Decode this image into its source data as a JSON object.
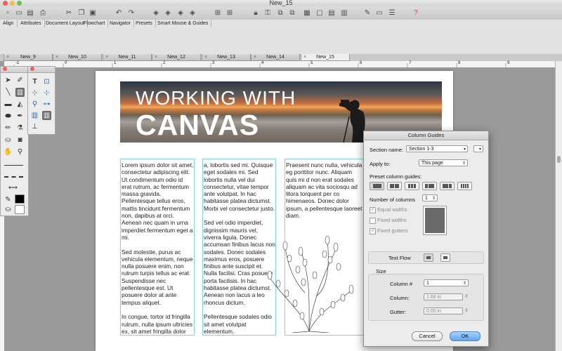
{
  "window": {
    "title": "New_15"
  },
  "colors": {
    "guide": "#7fd6df",
    "selected_tool": "#6b6b6b",
    "ok_button": "#5ea6ee"
  },
  "toolbar": {
    "icons": [
      "new-document-icon",
      "open-icon",
      "save-icon",
      "print-icon",
      "cut-icon",
      "copy-icon",
      "paste-icon",
      "undo-icon",
      "redo-icon",
      "bring-forward-icon",
      "send-backward-icon",
      "bring-front-icon",
      "send-back-icon",
      "grid-icon",
      "snap-grid-icon",
      "lock-icon",
      "unlock-icon",
      "group-icon",
      "ungroup-icon",
      "layers-icon",
      "crop-icon",
      "rulers-icon",
      "guides-icon",
      "pen-tool-icon",
      "preview-icon",
      "inspector-icon",
      "help-icon"
    ]
  },
  "palette_tabs": [
    "Align",
    "Attributes",
    "Document Layout",
    "Flowchart",
    "Navigator",
    "Presets",
    "Smart Mouse & Guides"
  ],
  "document_tabs": [
    {
      "label": "New_9",
      "active": false
    },
    {
      "label": "New_10",
      "active": false
    },
    {
      "label": "New_11",
      "active": false
    },
    {
      "label": "New_12",
      "active": false
    },
    {
      "label": "New_13",
      "active": false
    },
    {
      "label": "New_14",
      "active": false
    },
    {
      "label": "New_15",
      "active": true
    }
  ],
  "ruler": {
    "labels": [
      "-1",
      "0",
      "1",
      "2",
      "3",
      "4",
      "5",
      "6",
      "7",
      "8",
      "9"
    ]
  },
  "tools": {
    "left": [
      "arrow-tool-icon",
      "brush-tool-icon",
      "line-tool-icon",
      "column-text-tool-icon",
      "rectangle-tool-icon",
      "fill-tool-icon",
      "ellipse-tool-icon",
      "pencil-tool-icon",
      "pen-tool-icon",
      "eyedropper-tool-icon",
      "paint-bucket-tool-icon",
      "camera-tool-icon",
      "hand-tool-icon",
      "zoom-tool-icon"
    ],
    "right": [
      "text-tool-icon",
      "text-frame-tool-icon",
      "link-tool-icon",
      "unlink-tool-icon",
      "linked-frames-tool-icon",
      "connect-tool-icon",
      "column-frames-tool-icon",
      "columns-tool-icon",
      "stamp-tool-icon"
    ],
    "stroke": "#000000",
    "fill": "#ffffff"
  },
  "banner": {
    "line1": "WORKING WITH",
    "line2": "CANVAS"
  },
  "columns": [
    {
      "text": "Lorem ipsum dolor sit amet, consectetur adipiscing elit. Ut condimentum odio id erat rutrum, ac fermentum massa gravida. Pellentesque tellus eros, mattis tincidunt fermentum non, dapibus at orci. Aenean nec quam in urna imperdiet fermentum eget a mi.\n\nSed molestie, purus ac vehicula elementum, neque nulla posuere enim, non rutrum turpis tellus ac erat. Suspendisse nec pellentesque est. Ut posuere dolor at ante tempus aliquet.\n\nIn congue, tortor id fringilla rutrum, nulla ipsum ultricies ex, sit amet fringilla dolor tellus et orci. Fusce lectus nibh, semper non nunc id, dictum pharetra ipsum. Nunc tincidunt tempor enim aliquet imperdiet. Donec nibh ipsum, fermentum consequat ornare"
    },
    {
      "text": "a, lobortis sed mi. Quisque eget sodales mi. Sed lobortis nulla vel dui consectetur, vitae tempor ante volutpat. In hac habitasse platea dictumst. Morbi vel consectetur justo.\n\nSed vel odio imperdiet, dignissim mauris vel, viverra ligula. Donec accumsan finibus lacus non sodales. Donec sodales maximus eros, posuere finibus ante suscipit et. Nulla facilisi. Cras posuere porta facilisis. In hac habitasse platea dictumst. Aenean non lacus a leo rhoncus dictum.\n\nPellentesque sodales odio sit amet volutpat elementum."
    },
    {
      "text": "Praesent nunc nulla, vehicula eg porttitor nunc. Aliquam quis mi d non erat sodales aliquam ac vita sociosqu ad litora torquent per co himenaeos. Donec dolor ipsum, a pellentesque laoreet diam.\n\nDuis nec est diam. Integer pulvin interdum tellus ultrices vel. Morb euismod. Suspendisse vel sceler interdum massa ut, sit amet lacinia"
    }
  ],
  "dialog": {
    "title": "Column Guides",
    "section_name_label": "Section name:",
    "section_name_value": "Section 1-3",
    "apply_to_label": "Apply to:",
    "apply_to_value": "This page",
    "preset_label": "Preset column guides:",
    "number_label": "Number of columns",
    "number_value": "1",
    "equal_widths": "Equal widths",
    "fixed_widths": "Fixed widths",
    "fixed_gutters": "Fixed gutters",
    "text_flow_label": "Text Flow",
    "size_label": "Size",
    "column_num_label": "Column #",
    "column_num_value": "1",
    "column_label": "Column:",
    "column_value": "1.68 in",
    "gutter_label": "Gutter:",
    "gutter_value": "0.00 in",
    "cancel": "Cancel",
    "ok": "OK"
  }
}
